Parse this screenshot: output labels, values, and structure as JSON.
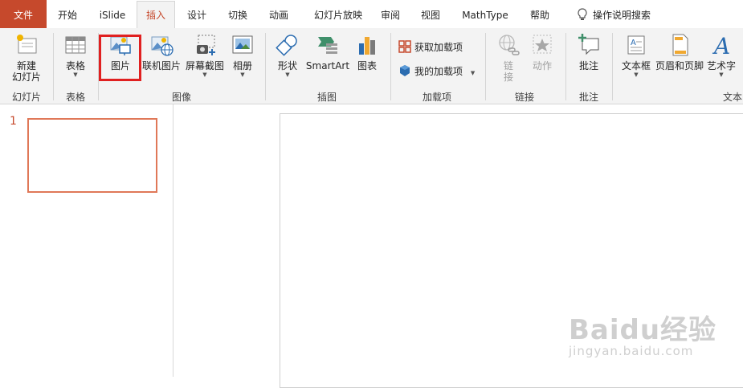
{
  "tabs": {
    "file": "文件",
    "home": "开始",
    "islide": "iSlide",
    "insert": "插入",
    "design": "设计",
    "transitions": "切换",
    "animations": "动画",
    "slideshow": "幻灯片放映",
    "review": "审阅",
    "view": "视图",
    "mathtype": "MathType",
    "help": "帮助",
    "tellme": "操作说明搜索"
  },
  "ribbon": {
    "new_slide": [
      "新建",
      "幻灯片"
    ],
    "table": "表格",
    "picture": "图片",
    "online_picture": "联机图片",
    "screenshot": "屏幕截图",
    "album": "相册",
    "shapes": "形状",
    "smartart": "SmartArt",
    "chart": "图表",
    "get_addins": "获取加载项",
    "my_addins": "我的加载项",
    "link": [
      "链",
      "接"
    ],
    "action": "动作",
    "comment": "批注",
    "textbox": "文本框",
    "header_footer": "页眉和页脚",
    "wordart": "艺术字",
    "groups": {
      "slides": "幻灯片",
      "tables": "表格",
      "images": "图像",
      "illustrations": "插图",
      "addins": "加载项",
      "links": "链接",
      "comments": "批注",
      "text": "文本"
    }
  },
  "slides_pane": {
    "slide_number": "1"
  },
  "watermark": {
    "brand": "Baidu经验",
    "url": "jingyan.baidu.com"
  },
  "colors": {
    "accent": "#c6492c",
    "highlight_box": "#e02020",
    "ribbon_bg": "#f3f3f3"
  }
}
